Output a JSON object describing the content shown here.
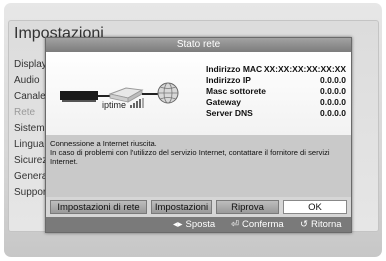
{
  "background": {
    "title": "Impostazioni",
    "menu": [
      "Display",
      "Audio",
      "Canale",
      "Rete",
      "Sistema",
      "Lingua",
      "Sicurezza",
      "Generale",
      "Supporto"
    ]
  },
  "dialog": {
    "title": "Stato rete",
    "diagram": {
      "router_label": "iptime"
    },
    "info": [
      {
        "label": "Indirizzo MAC",
        "value": "XX:XX:XX:XX:XX:XX"
      },
      {
        "label": "Indirizzo IP",
        "value": "0.0.0.0"
      },
      {
        "label": "Masc sottorete",
        "value": "0.0.0.0"
      },
      {
        "label": "Gateway",
        "value": "0.0.0.0"
      },
      {
        "label": "Server DNS",
        "value": "0.0.0.0"
      }
    ],
    "message_line1": "Connessione a Internet riuscita.",
    "message_line2": "In caso di problemi con l'utilizzo del servizio Internet, contattare il fornitore di servizi Internet.",
    "buttons": {
      "network_settings": "Impostazioni di rete",
      "ip_settings": "Impostazioni IP",
      "retry": "Riprova",
      "ok": "OK"
    },
    "hints": {
      "move": "Sposta",
      "move_icon": "◂▸",
      "confirm": "Conferma",
      "confirm_icon": "⏎",
      "back": "Ritorna",
      "back_icon": "↺"
    }
  }
}
